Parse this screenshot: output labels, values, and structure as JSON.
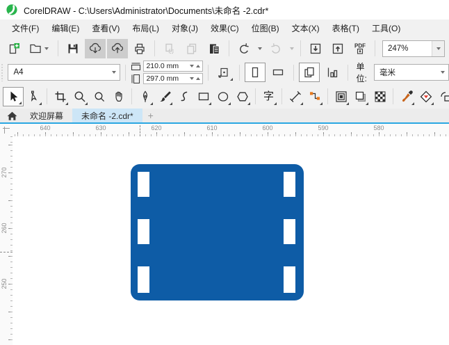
{
  "title_bar": {
    "app_title": "CorelDRAW - C:\\Users\\Administrator\\Documents\\未命名 -2.cdr*"
  },
  "menu": {
    "items": [
      {
        "label": "文件(F)"
      },
      {
        "label": "编辑(E)"
      },
      {
        "label": "查看(V)"
      },
      {
        "label": "布局(L)"
      },
      {
        "label": "对象(J)"
      },
      {
        "label": "效果(C)"
      },
      {
        "label": "位图(B)"
      },
      {
        "label": "文本(X)"
      },
      {
        "label": "表格(T)"
      },
      {
        "label": "工具(O)"
      }
    ]
  },
  "toolbar": {
    "zoom_level": "247%",
    "pdf_label": "PDF"
  },
  "property_bar": {
    "page_size_value": "A4",
    "page_width_value": "210.0 mm",
    "page_height_value": "297.0 mm",
    "units_label": "单位:",
    "units_value": "毫米"
  },
  "toolbox": {
    "text_tool_glyph": "字"
  },
  "tab_bar": {
    "tabs": [
      {
        "label": "欢迎屏幕"
      },
      {
        "label": "未命名 -2.cdr*"
      }
    ],
    "new_tab_label": "+"
  },
  "rulers": {
    "horizontal_labels": [
      "640",
      "630",
      "620",
      "610",
      "600",
      "590",
      "580"
    ],
    "vertical_labels": [
      "270",
      "260",
      "250"
    ]
  },
  "canvas": {
    "shape": {
      "type": "film-strip",
      "fill": "#0e5ca6"
    }
  }
}
